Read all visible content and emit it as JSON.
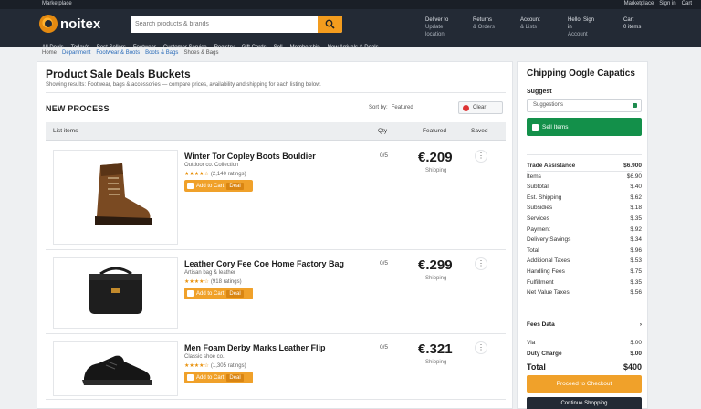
{
  "topbar": {
    "tagline": "Marketplace",
    "account": [
      "Marketplace",
      "Sign in",
      "Cart"
    ]
  },
  "header": {
    "logo": "noitex",
    "search_placeholder": "Search products & brands",
    "links": [
      {
        "line1": "Deliver to",
        "line2": "Update location"
      },
      {
        "line1": "Returns",
        "line2": "& Orders"
      },
      {
        "line1": "Account",
        "line2": "& Lists"
      },
      {
        "line1": "Hello, Sign in",
        "line2": "Account"
      }
    ],
    "cart": {
      "line1": "Cart",
      "line2": "0 items"
    },
    "nav": [
      "All Deals",
      "Today's",
      "Best Sellers",
      "Footwear",
      "Customer Service",
      "Registry",
      "Gift Cards",
      "Sell",
      "Membership",
      "New Arrivals & Deals"
    ]
  },
  "breadcrumb": [
    "Home",
    "Department",
    "Footwear & Boots",
    "Boots & Bags",
    "Shoes & Bags"
  ],
  "main": {
    "title": "Product Sale Deals Buckets",
    "subtitle": "Showing results: Footwear, bags & accessories — compare prices, availability and shipping for each listing below.",
    "section": "NEW PROCESS",
    "sort_label": "Sort by:",
    "sort_value": "Featured",
    "sort_button": "Clear",
    "columns": [
      "List items",
      "Qty",
      "Featured",
      "Saved"
    ],
    "items": [
      {
        "name": "Winter Tor Copley Boots Bouldier",
        "brand": "Outdoor co. Collection",
        "stars": "★★★★☆",
        "reviews": "(2,140 ratings)",
        "action": "Add to Cart",
        "tag": "Deal",
        "qty": "0/5",
        "price": "€.209",
        "availability": "Shipping"
      },
      {
        "name": "Leather Cory Fee Coe Home Factory Bag",
        "brand": "Artisan bag & leather",
        "stars": "★★★★☆",
        "reviews": "(918 ratings)",
        "action": "Add to Cart",
        "tag": "Deal",
        "qty": "0/5",
        "price": "€.299",
        "availability": "Shipping"
      },
      {
        "name": "Men Foam Derby Marks Leather Flip",
        "brand": "Classic shoe co.",
        "stars": "★★★★☆",
        "reviews": "(1,305 ratings)",
        "action": "Add to Cart",
        "tag": "Deal",
        "qty": "0/5",
        "price": "€.321",
        "availability": "Shipping"
      }
    ]
  },
  "sidebar": {
    "title": "Chipping Oogle Capatics",
    "label": "Suggest",
    "field_value": "Suggestions",
    "green_button": "Sell Items",
    "summary": [
      {
        "label": "Trade Assistance",
        "value": "$6.900"
      },
      {
        "label": "Items",
        "value": "$6.90"
      },
      {
        "label": "Subtotal",
        "value": "$.40"
      },
      {
        "label": "Est. Shipping",
        "value": "$.62"
      },
      {
        "label": "Subsidies",
        "value": "$.18"
      },
      {
        "label": "Services",
        "value": "$.35"
      },
      {
        "label": "Payment",
        "value": "$.92"
      },
      {
        "label": "Delivery Savings",
        "value": "$.34"
      },
      {
        "label": "Total",
        "value": "$.96"
      },
      {
        "label": "Additional Taxes",
        "value": "$.53"
      },
      {
        "label": "Handling Fees",
        "value": "$.75"
      },
      {
        "label": "Fulfillment",
        "value": "$.35"
      },
      {
        "label": "Net Value Taxes",
        "value": "$.56"
      }
    ],
    "fee_label": "Fees Data",
    "totals": [
      {
        "label": "Via",
        "value": "$.00"
      },
      {
        "label": "Duty Charge",
        "value": "$.00"
      }
    ],
    "total_label": "Total",
    "total_value": "$400",
    "orange_button": "Proceed to Checkout",
    "dark_button": "Continue Shopping"
  },
  "colors": {
    "header": "#232a35",
    "accent": "#f39c1e",
    "green": "#13904a"
  }
}
